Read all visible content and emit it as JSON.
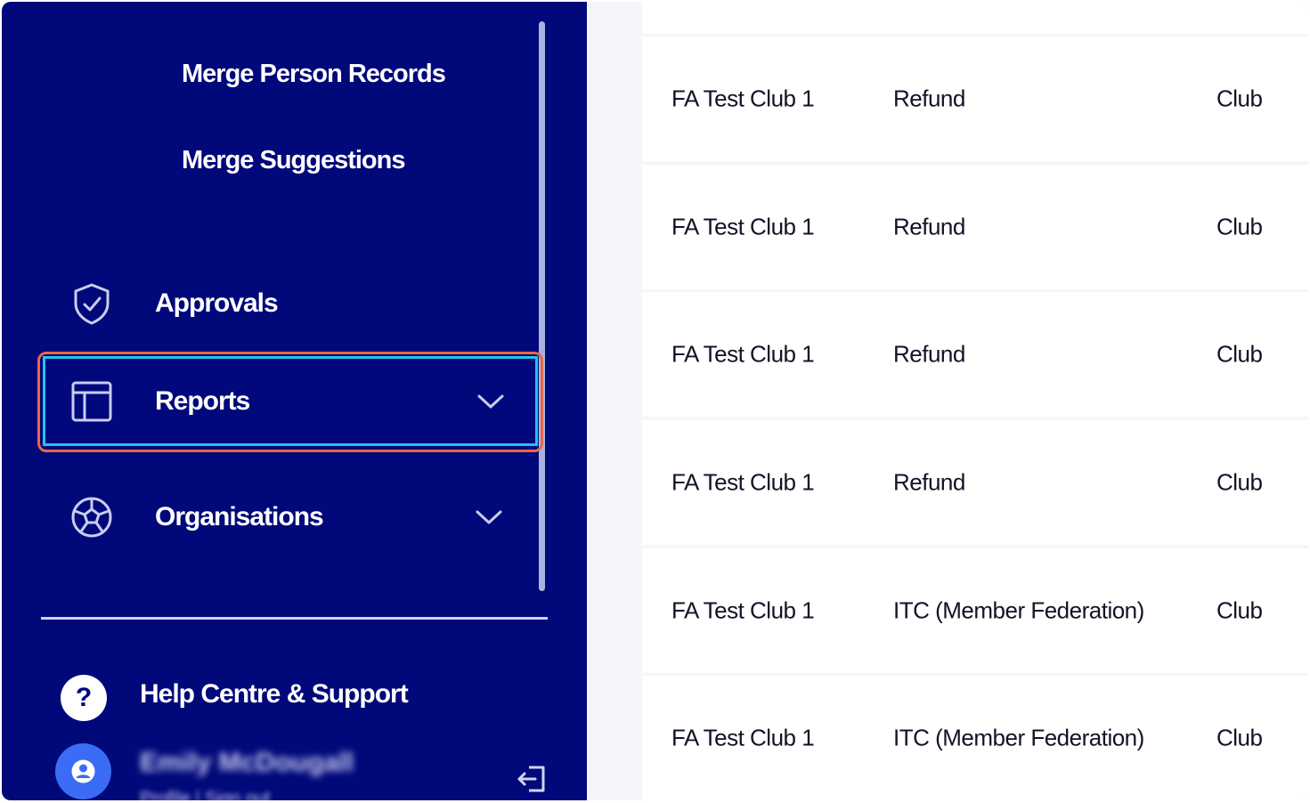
{
  "sidebar": {
    "sub_items": [
      "Merge Person Records",
      "Merge Suggestions"
    ],
    "nav": {
      "approvals": "Approvals",
      "reports": "Reports",
      "organisations": "Organisations"
    },
    "help_label": "Help Centre & Support",
    "help_glyph": "?",
    "user_name": "Emily McDougall",
    "user_links": "Profile | Sign out",
    "colors": {
      "sidebar_bg": "#00087a",
      "highlight_outer": "#e8683f",
      "highlight_inner": "#22c3ee",
      "avatar": "#3b6cf6"
    }
  },
  "table": {
    "rows": [
      {
        "club": "FA Test Club 1",
        "type": "Refund",
        "level": "Club"
      },
      {
        "club": "FA Test Club 1",
        "type": "Refund",
        "level": "Club"
      },
      {
        "club": "FA Test Club 1",
        "type": "Refund",
        "level": "Club"
      },
      {
        "club": "FA Test Club 1",
        "type": "Refund",
        "level": "Club"
      },
      {
        "club": "FA Test Club 1",
        "type": "ITC (Member Federation)",
        "level": "Club"
      },
      {
        "club": "FA Test Club 1",
        "type": "ITC (Member Federation)",
        "level": "Club"
      }
    ]
  }
}
